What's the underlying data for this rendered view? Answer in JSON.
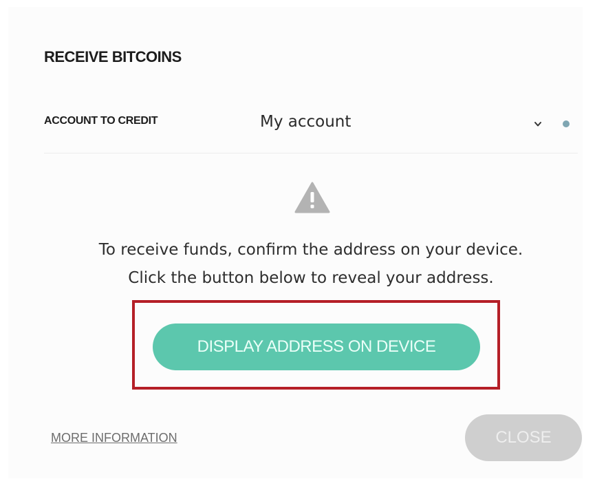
{
  "modal": {
    "title": "RECEIVE BITCOINS",
    "account": {
      "label": "ACCOUNT TO CREDIT",
      "selected": "My account",
      "status_color": "#7fa6b2"
    },
    "warning_icon": "warning-triangle-icon",
    "message": {
      "line1": "To receive funds, confirm the address on your device.",
      "line2": "Click the button below to reveal your address."
    },
    "display_button": {
      "label": "DISPLAY ADDRESS ON DEVICE",
      "color": "#5cc7ad"
    },
    "highlight_color": "#b51f27",
    "more_info_link": "MORE INFORMATION",
    "close_button": {
      "label": "CLOSE",
      "color": "#cfcfcf"
    }
  }
}
